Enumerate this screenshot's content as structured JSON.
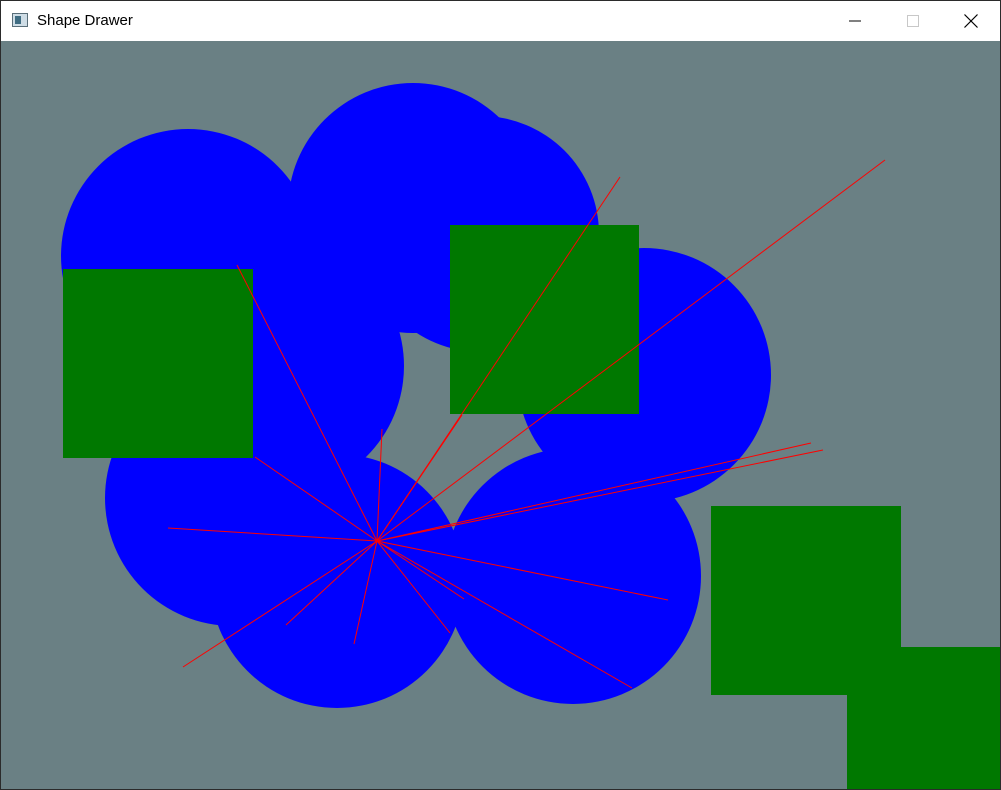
{
  "window": {
    "title": "Shape Drawer"
  },
  "titlebar_buttons": {
    "minimize_icon": "minimize-icon",
    "maximize_icon": "maximize-icon",
    "close_icon": "close-icon"
  },
  "canvas": {
    "background_color": "#6a8084",
    "circle_color": "#0000ff",
    "square_color": "#007800",
    "line_color": "#ff0000"
  }
}
